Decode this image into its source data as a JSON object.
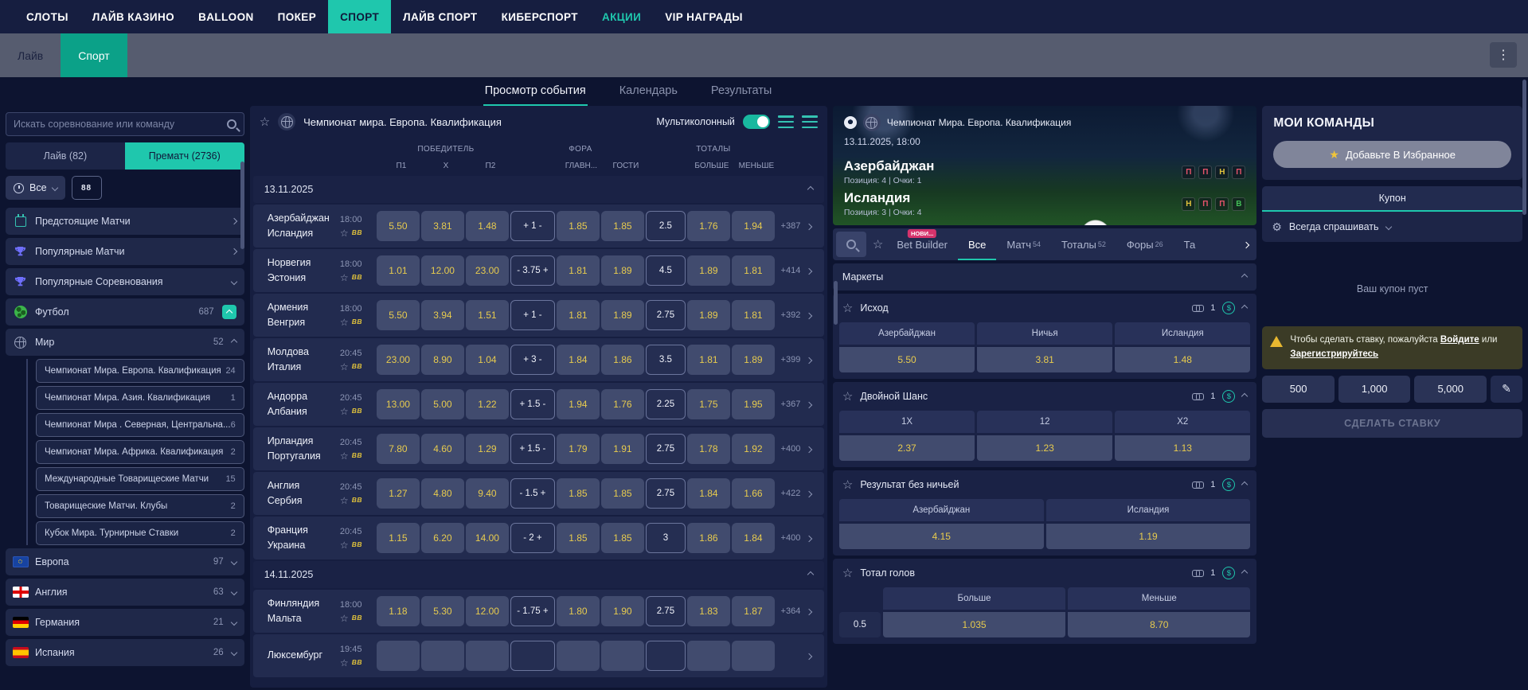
{
  "colors": {
    "accent": "#1fc7ad",
    "odds_text": "#e7cb4e",
    "nav_bg": "#161e40",
    "mode_green": "#0ba188",
    "warn_bg": "#3b3b26",
    "form_win": "#43c058",
    "form_loss": "#e5536a",
    "form_draw": "#e0c23c"
  },
  "top_nav": {
    "items": [
      {
        "label": "СЛОТЫ"
      },
      {
        "label": "ЛАЙВ КАЗИНО"
      },
      {
        "label": "BALLOON"
      },
      {
        "label": "ПОКЕР"
      },
      {
        "label": "СПОРТ",
        "active": true
      },
      {
        "label": "ЛАЙВ СПОРТ"
      },
      {
        "label": "КИБЕРСПОРТ"
      },
      {
        "label": "АКЦИИ",
        "highlight": true
      },
      {
        "label": "VIP НАГРАДЫ"
      }
    ]
  },
  "mode_bar": {
    "tabs": [
      {
        "label": "Лайв"
      },
      {
        "label": "Спорт",
        "active": true
      }
    ],
    "menu_icon": "⋮"
  },
  "view_tabs": [
    {
      "label": "Просмотр события",
      "active": true
    },
    {
      "label": "Календарь"
    },
    {
      "label": "Результаты"
    }
  ],
  "sidebar": {
    "search_placeholder": "Искать соревнование или команду",
    "tabs": [
      {
        "label": "Лайв (82)"
      },
      {
        "label": "Прематч (2736)",
        "active": true
      }
    ],
    "filter_all_label": "Все",
    "odds_format_label": "88",
    "items": [
      {
        "type": "icon",
        "icon": "calendar-icon",
        "label": "Предстоящие Матчи",
        "chev": "r"
      },
      {
        "type": "icon",
        "icon": "trophy-icon",
        "label": "Популярные Матчи",
        "chev": "r"
      },
      {
        "type": "icon",
        "icon": "trophy-icon",
        "label": "Популярные Соревнования",
        "chev": "d"
      },
      {
        "type": "icon",
        "icon": "football-icon",
        "label": "Футбол",
        "count": "687",
        "badge_up": true
      },
      {
        "type": "icon",
        "icon": "globe-icon",
        "label": "Мир",
        "count": "52",
        "chev": "u"
      },
      {
        "type": "sub",
        "label": "Чемпионат Мира. Европа. Квалификация",
        "count": "24"
      },
      {
        "type": "sub",
        "label": "Чемпионат Мира. Азия. Квалификация",
        "count": "1"
      },
      {
        "type": "sub",
        "label": "Чемпионат Мира . Северная, Центральна...",
        "count": "6"
      },
      {
        "type": "sub",
        "label": "Чемпионат Мира. Африка. Квалификация",
        "count": "2"
      },
      {
        "type": "sub",
        "label": "Международные Товарищеские Матчи",
        "count": "15"
      },
      {
        "type": "sub",
        "label": "Товарищеские Матчи. Клубы",
        "count": "2"
      },
      {
        "type": "sub",
        "label": "Кубок Мира. Турнирные Ставки",
        "count": "2"
      },
      {
        "type": "flag",
        "flag": "eu",
        "label": "Европа",
        "count": "97",
        "chev": "d"
      },
      {
        "type": "flag",
        "flag": "england",
        "label": "Англия",
        "count": "63",
        "chev": "d"
      },
      {
        "type": "flag",
        "flag": "germany",
        "label": "Германия",
        "count": "21",
        "chev": "d"
      },
      {
        "type": "flag",
        "flag": "spain",
        "label": "Испания",
        "count": "26",
        "chev": "d"
      }
    ]
  },
  "events_panel": {
    "title": "Чемпионат мира. Европа. Квалификация",
    "multicolumn_label": "Мультиколонный",
    "col_groups": {
      "winner": "ПОБЕДИТЕЛЬ",
      "handicap": "ФОРА",
      "totals": "ТОТАЛЫ"
    },
    "col_headers": {
      "p1": "П1",
      "x": "X",
      "p2": "П2",
      "home": "ГЛАВН...",
      "away": "ГОСТИ",
      "over": "БОЛЬШЕ",
      "under": "МЕНЬШЕ"
    },
    "bet_builder_mini": "BB",
    "groups": [
      {
        "date": "13.11.2025",
        "matches": [
          {
            "home": "Азербайджан",
            "away": "Исландия",
            "time": "18:00",
            "p1": "5.50",
            "x": "3.81",
            "p2": "1.48",
            "h_line": "+ 1 -",
            "h_home": "1.85",
            "h_away": "1.85",
            "t_line": "2.5",
            "over": "1.76",
            "under": "1.94",
            "move": "+387"
          },
          {
            "home": "Норвегия",
            "away": "Эстония",
            "time": "18:00",
            "p1": "1.01",
            "x": "12.00",
            "p2": "23.00",
            "h_line": "- 3.75 +",
            "h_home": "1.81",
            "h_away": "1.89",
            "t_line": "4.5",
            "over": "1.89",
            "under": "1.81",
            "move": "+414"
          },
          {
            "home": "Армения",
            "away": "Венгрия",
            "time": "18:00",
            "p1": "5.50",
            "x": "3.94",
            "p2": "1.51",
            "h_line": "+ 1 -",
            "h_home": "1.81",
            "h_away": "1.89",
            "t_line": "2.75",
            "over": "1.89",
            "under": "1.81",
            "move": "+392"
          },
          {
            "home": "Молдова",
            "away": "Италия",
            "time": "20:45",
            "p1": "23.00",
            "x": "8.90",
            "p2": "1.04",
            "h_line": "+ 3 -",
            "h_home": "1.84",
            "h_away": "1.86",
            "t_line": "3.5",
            "over": "1.81",
            "under": "1.89",
            "move": "+399"
          },
          {
            "home": "Андорра",
            "away": "Албания",
            "time": "20:45",
            "p1": "13.00",
            "x": "5.00",
            "p2": "1.22",
            "h_line": "+ 1.5 -",
            "h_home": "1.94",
            "h_away": "1.76",
            "t_line": "2.25",
            "over": "1.75",
            "under": "1.95",
            "move": "+367"
          },
          {
            "home": "Ирландия",
            "away": "Португалия",
            "time": "20:45",
            "p1": "7.80",
            "x": "4.60",
            "p2": "1.29",
            "h_line": "+ 1.5 -",
            "h_home": "1.79",
            "h_away": "1.91",
            "t_line": "2.75",
            "over": "1.78",
            "under": "1.92",
            "move": "+400"
          },
          {
            "home": "Англия",
            "away": "Сербия",
            "time": "20:45",
            "p1": "1.27",
            "x": "4.80",
            "p2": "9.40",
            "h_line": "- 1.5 +",
            "h_home": "1.85",
            "h_away": "1.85",
            "t_line": "2.75",
            "over": "1.84",
            "under": "1.66",
            "move": "+422"
          },
          {
            "home": "Франция",
            "away": "Украина",
            "time": "20:45",
            "p1": "1.15",
            "x": "6.20",
            "p2": "14.00",
            "h_line": "- 2 +",
            "h_home": "1.85",
            "h_away": "1.85",
            "t_line": "3",
            "over": "1.86",
            "under": "1.84",
            "move": "+400"
          }
        ]
      },
      {
        "date": "14.11.2025",
        "matches": [
          {
            "home": "Финляндия",
            "away": "Мальта",
            "time": "18:00",
            "p1": "1.18",
            "x": "5.30",
            "p2": "12.00",
            "h_line": "- 1.75 +",
            "h_home": "1.80",
            "h_away": "1.90",
            "t_line": "2.75",
            "over": "1.83",
            "under": "1.87",
            "move": "+364"
          },
          {
            "home": "Люксембург",
            "away": "",
            "time": "19:45",
            "p1": "",
            "x": "",
            "p2": "",
            "h_line": "",
            "h_home": "",
            "h_away": "",
            "t_line": "",
            "over": "",
            "under": "",
            "move": ""
          }
        ]
      }
    ]
  },
  "detail_panel": {
    "league": "Чемпионат Мира. Европа. Квалификация",
    "datetime": "13.11.2025, 18:00",
    "teams": [
      {
        "name": "Азербайджан",
        "meta": "Позиция: 4 | Очки: 1",
        "form": [
          {
            "l": "П",
            "c": "loss"
          },
          {
            "l": "П",
            "c": "loss"
          },
          {
            "l": "Н",
            "c": "draw"
          },
          {
            "l": "П",
            "c": "loss"
          }
        ]
      },
      {
        "name": "Исландия",
        "meta": "Позиция: 3 | Очки: 4",
        "form": [
          {
            "l": "Н",
            "c": "draw"
          },
          {
            "l": "П",
            "c": "loss"
          },
          {
            "l": "П",
            "c": "loss"
          },
          {
            "l": "В",
            "c": "win"
          }
        ]
      }
    ],
    "tabs": [
      {
        "label": "Bet Builder",
        "badge": "НОВИ..."
      },
      {
        "label": "Все",
        "active": true
      },
      {
        "label": "Матч",
        "count": "54"
      },
      {
        "label": "Тоталы",
        "count": "52"
      },
      {
        "label": "Форы",
        "count": "26"
      },
      {
        "label": "Та"
      }
    ],
    "markets_header": "Маркеты",
    "markets": [
      {
        "name": "Исход",
        "link_count": "1",
        "columns": [
          "Азербайджан",
          "Ничья",
          "Исландия"
        ],
        "odds": [
          "5.50",
          "3.81",
          "1.48"
        ]
      },
      {
        "name": "Двойной Шанс",
        "link_count": "1",
        "columns": [
          "1X",
          "12",
          "X2"
        ],
        "odds": [
          "2.37",
          "1.23",
          "1.13"
        ]
      },
      {
        "name": "Результат без ничьей",
        "link_count": "1",
        "columns": [
          "Азербайджан",
          "Исландия"
        ],
        "odds": [
          "4.15",
          "1.19"
        ]
      },
      {
        "name": "Тотал голов",
        "link_count": "1",
        "line": "0.5",
        "columns": [
          "Больше",
          "Меньше"
        ],
        "odds": [
          "1.035",
          "8.70"
        ]
      }
    ]
  },
  "betslip": {
    "my_teams_title": "МОИ КОМАНДЫ",
    "add_favorite_label": "Добавьте В Избранное",
    "coupon_tab": "Купон",
    "ask_label": "Всегда спрашивать",
    "empty_text": "Ваш купон пуст",
    "warning": {
      "prefix": "Чтобы сделать ставку, пожалуйста",
      "login": "Войдите",
      "or": "или",
      "register": "Зарегистрируйтесь"
    },
    "stakes": [
      "500",
      "1,000",
      "5,000"
    ],
    "place_bet_label": "СДЕЛАТЬ СТАВКУ"
  }
}
